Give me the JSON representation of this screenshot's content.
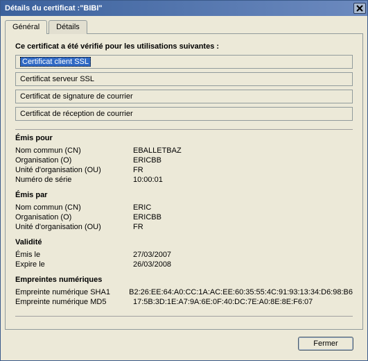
{
  "window": {
    "title": "Détails du certificat :\"BIBI\""
  },
  "tabs": [
    {
      "label": "Général"
    },
    {
      "label": "Détails"
    }
  ],
  "verified_heading": "Ce certificat a été vérifié pour les utilisations suivantes :",
  "usages": [
    "Certificat client SSL",
    "Certificat serveur SSL",
    "Certificat de signature de courrier",
    "Certificat de réception de courrier"
  ],
  "issued_for": {
    "heading": "Émis pour",
    "cn_label": "Nom commun (CN)",
    "cn_value": "EBALLETBAZ",
    "o_label": "Organisation (O)",
    "o_value": "ERICBB",
    "ou_label": "Unité d'organisation (OU)",
    "ou_value": "FR",
    "serial_label": "Numéro de série",
    "serial_value": "10:00:01"
  },
  "issued_by": {
    "heading": "Émis par",
    "cn_label": "Nom commun (CN)",
    "cn_value": "ERIC",
    "o_label": "Organisation (O)",
    "o_value": "ERICBB",
    "ou_label": "Unité d'organisation (OU)",
    "ou_value": "FR"
  },
  "validity": {
    "heading": "Validité",
    "issued_label": "Émis le",
    "issued_value": "27/03/2007",
    "expires_label": "Expire le",
    "expires_value": "26/03/2008"
  },
  "fingerprints": {
    "heading": "Empreintes numériques",
    "sha1_label": "Empreinte numérique SHA1",
    "sha1_value": "B2:26:EE:64:A0:CC:1A:AC:EE:60:35:55:4C:91:93:13:34:D6:98:B6",
    "md5_label": "Empreinte numérique MD5",
    "md5_value": "17:5B:3D:1E:A7:9A:6E:0F:40:DC:7E:A0:8E:8E:F6:07"
  },
  "buttons": {
    "close": "Fermer"
  }
}
